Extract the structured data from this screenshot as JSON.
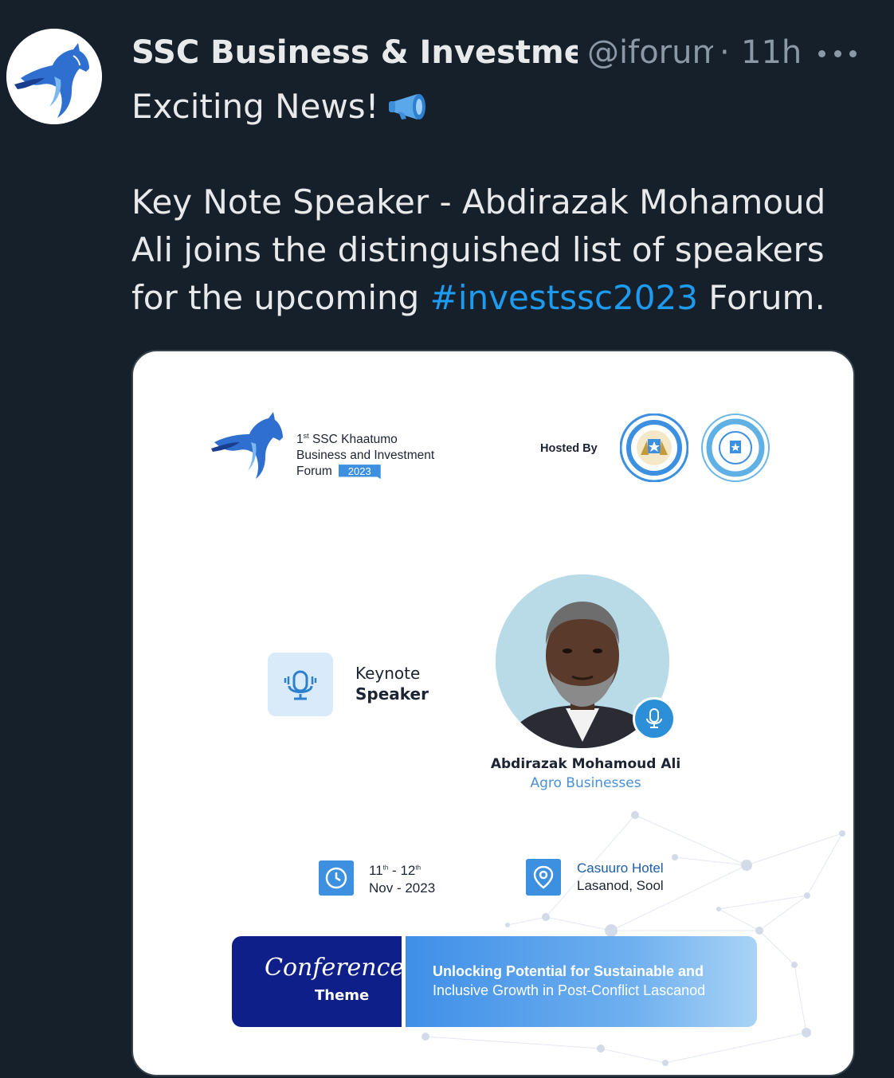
{
  "tweet": {
    "author_name": "SSC Business & Investment",
    "handle": "@iforum",
    "separator": "·",
    "time": "11h",
    "text_line1": "Exciting News!",
    "body_part1": "Key Note Speaker - Abdirazak Mohamoud Ali joins the distinguished list of speakers for the upcoming ",
    "hashtag": "#investssc2023",
    "body_part2": " Forum."
  },
  "icons": {
    "avatar": "horse-logo-icon",
    "megaphone": "megaphone-icon",
    "more": "more-options-icon"
  },
  "card": {
    "forum_ordinal_num": "1",
    "forum_ordinal_suffix": "st",
    "forum_line1_rest": " SSC Khaatumo",
    "forum_line2": "Business and Investment",
    "forum_line3": "Forum",
    "forum_year": "2023",
    "hosted_by": "Hosted By",
    "keynote_line1": "Keynote",
    "keynote_line2": "Speaker",
    "speaker_name": "Abdirazak Mohamoud Ali",
    "speaker_org": "Agro Businesses",
    "date_day1": "11",
    "date_sup1": "th",
    "date_dash": " - ",
    "date_day2": "12",
    "date_sup2": "th",
    "date_line2": "Nov - 2023",
    "venue_line1": "Casuuro Hotel",
    "venue_line2": "Lasanod, Sool",
    "theme_script": "Conference",
    "theme_word": "Theme",
    "theme_line1": "Unlocking Potential for Sustainable and",
    "theme_line2": "Inclusive Growth in Post-Conflict Lascanod"
  },
  "colors": {
    "background": "#15202b",
    "text_primary": "#e7e9ea",
    "text_secondary": "#8b98a5",
    "link": "#1d9bf0",
    "brand_blue": "#3d8fe0",
    "brand_navy": "#0e1f8a"
  }
}
